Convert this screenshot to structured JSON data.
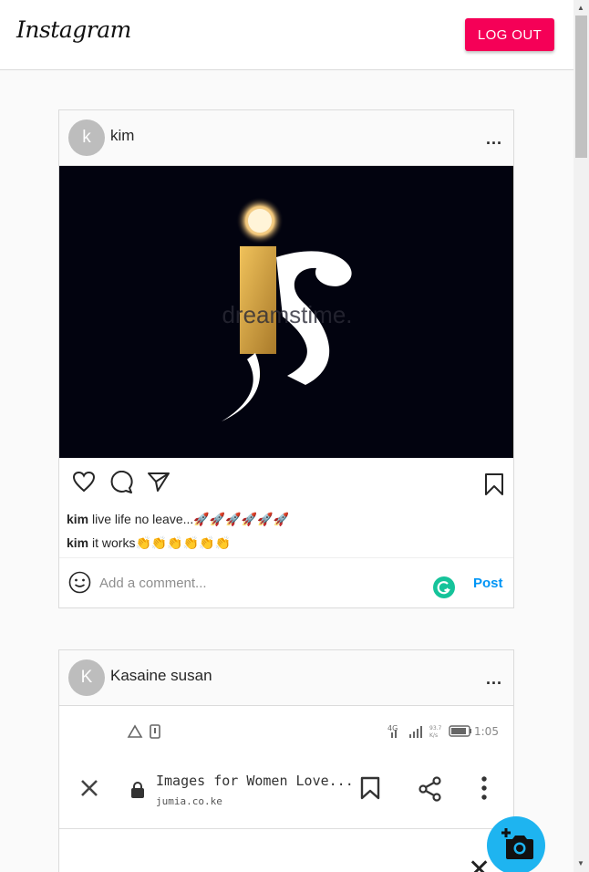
{
  "header": {
    "logo_text": "Instagram",
    "logout_label": "LOG OUT",
    "logout_color": "#f50057"
  },
  "posts": [
    {
      "avatar_letter": "k",
      "username": "kim",
      "more_label": "...",
      "image_watermark": "dreamstime.",
      "comments": [
        {
          "user": "kim",
          "text": "live life no leave...🚀🚀🚀🚀🚀🚀"
        },
        {
          "user": "kim",
          "text": "it works👏👏👏👏👏👏"
        }
      ],
      "comment_placeholder": "Add a comment...",
      "post_label": "Post"
    },
    {
      "avatar_letter": "K",
      "username": "Kasaine susan",
      "more_label": "...",
      "screenshot": {
        "status_right": "1:05",
        "page_title": "Images for Women Love...",
        "page_domain": "jumia.co.ke"
      }
    }
  ],
  "icons": {
    "like": "heart-icon",
    "comment": "comment-icon",
    "share": "send-icon",
    "save": "bookmark-icon",
    "emoji": "emoji-icon",
    "fab": "add-photo-icon"
  },
  "colors": {
    "link_blue": "#0095f6",
    "fab_blue": "#1eb4f0",
    "grammarly_green": "#15c39a"
  }
}
